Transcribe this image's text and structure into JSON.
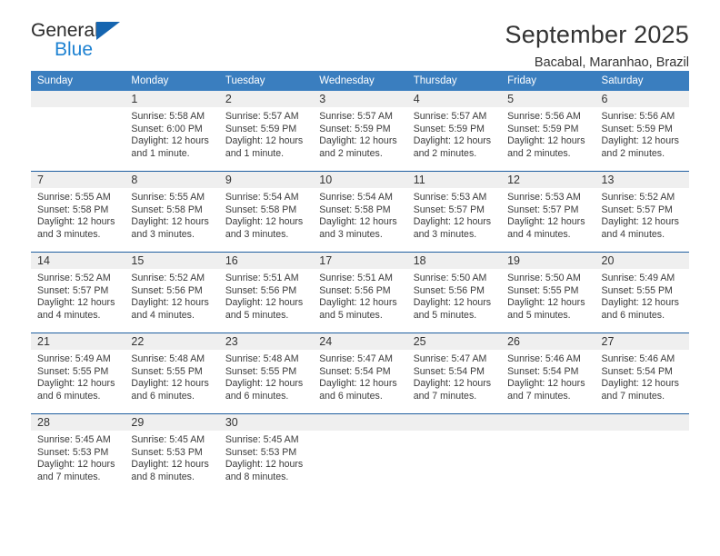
{
  "logo": {
    "word1": "General",
    "word2": "Blue",
    "triangle_color": "#1565b0",
    "blue_color": "#1e82d2"
  },
  "header": {
    "title": "September 2025",
    "subtitle": "Bacabal, Maranhao, Brazil"
  },
  "theme": {
    "header_bg": "#3a7ebf",
    "row_divider": "#1f5fa0",
    "daynum_bg": "#efefef"
  },
  "calendar": {
    "weekday_headers": [
      "Sunday",
      "Monday",
      "Tuesday",
      "Wednesday",
      "Thursday",
      "Friday",
      "Saturday"
    ],
    "weeks": [
      [
        {
          "day": "",
          "sunrise": "",
          "sunset": "",
          "daylight": ""
        },
        {
          "day": "1",
          "sunrise": "Sunrise: 5:58 AM",
          "sunset": "Sunset: 6:00 PM",
          "daylight": "Daylight: 12 hours and 1 minute."
        },
        {
          "day": "2",
          "sunrise": "Sunrise: 5:57 AM",
          "sunset": "Sunset: 5:59 PM",
          "daylight": "Daylight: 12 hours and 1 minute."
        },
        {
          "day": "3",
          "sunrise": "Sunrise: 5:57 AM",
          "sunset": "Sunset: 5:59 PM",
          "daylight": "Daylight: 12 hours and 2 minutes."
        },
        {
          "day": "4",
          "sunrise": "Sunrise: 5:57 AM",
          "sunset": "Sunset: 5:59 PM",
          "daylight": "Daylight: 12 hours and 2 minutes."
        },
        {
          "day": "5",
          "sunrise": "Sunrise: 5:56 AM",
          "sunset": "Sunset: 5:59 PM",
          "daylight": "Daylight: 12 hours and 2 minutes."
        },
        {
          "day": "6",
          "sunrise": "Sunrise: 5:56 AM",
          "sunset": "Sunset: 5:59 PM",
          "daylight": "Daylight: 12 hours and 2 minutes."
        }
      ],
      [
        {
          "day": "7",
          "sunrise": "Sunrise: 5:55 AM",
          "sunset": "Sunset: 5:58 PM",
          "daylight": "Daylight: 12 hours and 3 minutes."
        },
        {
          "day": "8",
          "sunrise": "Sunrise: 5:55 AM",
          "sunset": "Sunset: 5:58 PM",
          "daylight": "Daylight: 12 hours and 3 minutes."
        },
        {
          "day": "9",
          "sunrise": "Sunrise: 5:54 AM",
          "sunset": "Sunset: 5:58 PM",
          "daylight": "Daylight: 12 hours and 3 minutes."
        },
        {
          "day": "10",
          "sunrise": "Sunrise: 5:54 AM",
          "sunset": "Sunset: 5:58 PM",
          "daylight": "Daylight: 12 hours and 3 minutes."
        },
        {
          "day": "11",
          "sunrise": "Sunrise: 5:53 AM",
          "sunset": "Sunset: 5:57 PM",
          "daylight": "Daylight: 12 hours and 3 minutes."
        },
        {
          "day": "12",
          "sunrise": "Sunrise: 5:53 AM",
          "sunset": "Sunset: 5:57 PM",
          "daylight": "Daylight: 12 hours and 4 minutes."
        },
        {
          "day": "13",
          "sunrise": "Sunrise: 5:52 AM",
          "sunset": "Sunset: 5:57 PM",
          "daylight": "Daylight: 12 hours and 4 minutes."
        }
      ],
      [
        {
          "day": "14",
          "sunrise": "Sunrise: 5:52 AM",
          "sunset": "Sunset: 5:57 PM",
          "daylight": "Daylight: 12 hours and 4 minutes."
        },
        {
          "day": "15",
          "sunrise": "Sunrise: 5:52 AM",
          "sunset": "Sunset: 5:56 PM",
          "daylight": "Daylight: 12 hours and 4 minutes."
        },
        {
          "day": "16",
          "sunrise": "Sunrise: 5:51 AM",
          "sunset": "Sunset: 5:56 PM",
          "daylight": "Daylight: 12 hours and 5 minutes."
        },
        {
          "day": "17",
          "sunrise": "Sunrise: 5:51 AM",
          "sunset": "Sunset: 5:56 PM",
          "daylight": "Daylight: 12 hours and 5 minutes."
        },
        {
          "day": "18",
          "sunrise": "Sunrise: 5:50 AM",
          "sunset": "Sunset: 5:56 PM",
          "daylight": "Daylight: 12 hours and 5 minutes."
        },
        {
          "day": "19",
          "sunrise": "Sunrise: 5:50 AM",
          "sunset": "Sunset: 5:55 PM",
          "daylight": "Daylight: 12 hours and 5 minutes."
        },
        {
          "day": "20",
          "sunrise": "Sunrise: 5:49 AM",
          "sunset": "Sunset: 5:55 PM",
          "daylight": "Daylight: 12 hours and 6 minutes."
        }
      ],
      [
        {
          "day": "21",
          "sunrise": "Sunrise: 5:49 AM",
          "sunset": "Sunset: 5:55 PM",
          "daylight": "Daylight: 12 hours and 6 minutes."
        },
        {
          "day": "22",
          "sunrise": "Sunrise: 5:48 AM",
          "sunset": "Sunset: 5:55 PM",
          "daylight": "Daylight: 12 hours and 6 minutes."
        },
        {
          "day": "23",
          "sunrise": "Sunrise: 5:48 AM",
          "sunset": "Sunset: 5:55 PM",
          "daylight": "Daylight: 12 hours and 6 minutes."
        },
        {
          "day": "24",
          "sunrise": "Sunrise: 5:47 AM",
          "sunset": "Sunset: 5:54 PM",
          "daylight": "Daylight: 12 hours and 6 minutes."
        },
        {
          "day": "25",
          "sunrise": "Sunrise: 5:47 AM",
          "sunset": "Sunset: 5:54 PM",
          "daylight": "Daylight: 12 hours and 7 minutes."
        },
        {
          "day": "26",
          "sunrise": "Sunrise: 5:46 AM",
          "sunset": "Sunset: 5:54 PM",
          "daylight": "Daylight: 12 hours and 7 minutes."
        },
        {
          "day": "27",
          "sunrise": "Sunrise: 5:46 AM",
          "sunset": "Sunset: 5:54 PM",
          "daylight": "Daylight: 12 hours and 7 minutes."
        }
      ],
      [
        {
          "day": "28",
          "sunrise": "Sunrise: 5:45 AM",
          "sunset": "Sunset: 5:53 PM",
          "daylight": "Daylight: 12 hours and 7 minutes."
        },
        {
          "day": "29",
          "sunrise": "Sunrise: 5:45 AM",
          "sunset": "Sunset: 5:53 PM",
          "daylight": "Daylight: 12 hours and 8 minutes."
        },
        {
          "day": "30",
          "sunrise": "Sunrise: 5:45 AM",
          "sunset": "Sunset: 5:53 PM",
          "daylight": "Daylight: 12 hours and 8 minutes."
        },
        {
          "day": "",
          "sunrise": "",
          "sunset": "",
          "daylight": ""
        },
        {
          "day": "",
          "sunrise": "",
          "sunset": "",
          "daylight": ""
        },
        {
          "day": "",
          "sunrise": "",
          "sunset": "",
          "daylight": ""
        },
        {
          "day": "",
          "sunrise": "",
          "sunset": "",
          "daylight": ""
        }
      ]
    ]
  }
}
